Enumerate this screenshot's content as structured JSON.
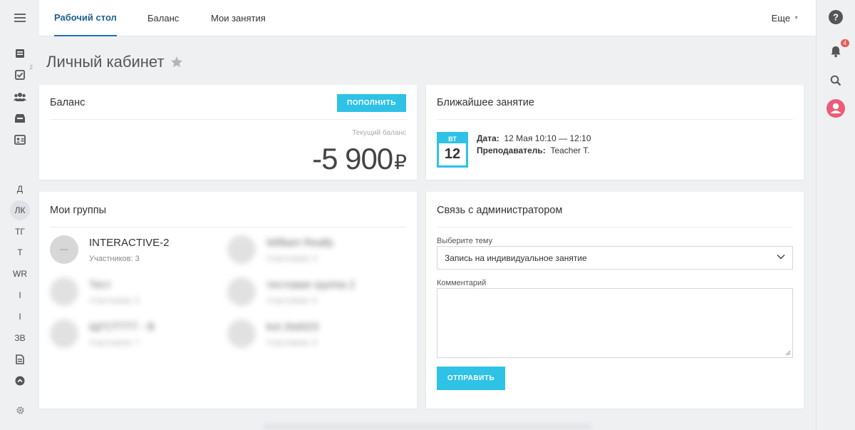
{
  "nav": {
    "tabs": [
      "Рабочий стол",
      "Баланс",
      "Мои занятия"
    ],
    "active_tab": 0,
    "more_label": "Еще"
  },
  "left_sidebar": {
    "icon_items": [
      {
        "icon": "menu-icon"
      },
      {
        "icon": "news-icon"
      },
      {
        "icon": "tasks-icon",
        "badge": "2"
      },
      {
        "icon": "users-icon"
      },
      {
        "icon": "inbox-icon"
      },
      {
        "icon": "id-card-icon"
      }
    ],
    "text_items": [
      "Д",
      "ЛК",
      "ТГ",
      "Т",
      "WR",
      "I",
      "I",
      "ЗВ"
    ],
    "active_text_item": "ЛК",
    "bottom_icons": [
      "document-icon",
      "chevron-up-circle-icon",
      "settings-icon"
    ]
  },
  "right_sidebar": {
    "help_icon": "help-icon",
    "notifications_badge": "4"
  },
  "page": {
    "title": "Личный кабинет"
  },
  "balance_card": {
    "title": "Баланс",
    "topup_button": "ПОПОЛНИТЬ",
    "current_label": "Текущий баланс",
    "amount": "-5 900",
    "currency": "₽"
  },
  "next_lesson_card": {
    "title": "Ближайшее занятие",
    "weekday": "ВТ",
    "day": "12",
    "date_label": "Дата:",
    "date_value": "12 Мая 10:10 — 12:10",
    "teacher_label": "Преподаватель:",
    "teacher_value": "Teacher T."
  },
  "groups_card": {
    "title": "Мои группы",
    "groups": [
      {
        "name": "INTERACTIVE-2",
        "members": "Участников: 3"
      },
      {
        "name": "William Really",
        "members": "Участников: 4"
      },
      {
        "name": "Тест",
        "members": "Участников: 6"
      },
      {
        "name": "тестовая группа 2",
        "members": "Участников: 6"
      },
      {
        "name": "ЩГСТТТТ - В",
        "members": "Участников: 7"
      },
      {
        "name": "kot 2tst023",
        "members": "Участников: 8"
      }
    ]
  },
  "contact_card": {
    "title": "Связь с администратором",
    "topic_label": "Выберите тему",
    "topic_value": "Запись на индивидуальное занятие",
    "comment_label": "Комментарий",
    "comment_value": "",
    "send_button": "ОТПРАВИТЬ"
  },
  "colors": {
    "accent": "#2ec2e6",
    "active_tab": "#1f6fb5",
    "badge": "#e85b5b",
    "avatar": "#ec5b78"
  }
}
